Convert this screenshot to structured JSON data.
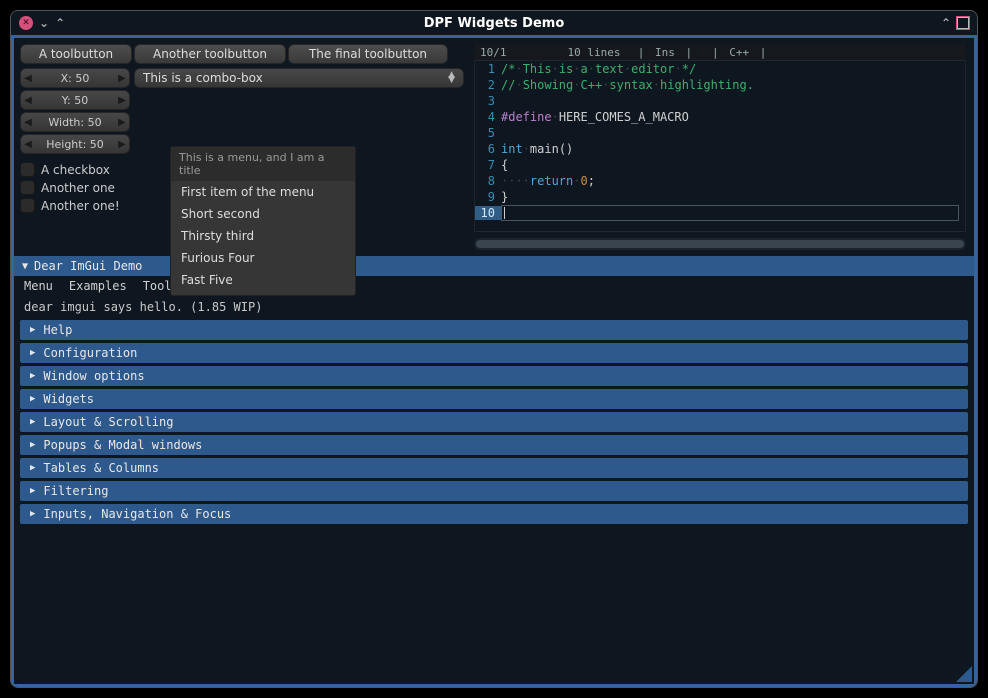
{
  "window": {
    "title": "DPF Widgets Demo"
  },
  "toolbar": {
    "b1": "A toolbutton",
    "b2": "Another toolbutton",
    "b3": "The final toolbutton"
  },
  "spinners": {
    "x": "X: 50",
    "y": "Y: 50",
    "w": "Width: 50",
    "h": "Height: 50"
  },
  "combo": {
    "label": "This is a combo-box"
  },
  "checks": {
    "c1": "A checkbox",
    "c2": "Another one",
    "c3": "Another one!"
  },
  "menu": {
    "title": "This is a menu, and I am a title",
    "items": [
      "First item of the menu",
      "Short second",
      "Thirsty third",
      "Furious Four",
      "Fast Five"
    ]
  },
  "editor": {
    "status": {
      "pos": "10/1",
      "lines": "10 lines",
      "ins": "Ins",
      "lang": "C++"
    },
    "lines": [
      {
        "n": "1",
        "parts": [
          {
            "t": "/*",
            "c": "comment"
          },
          {
            "t": "·",
            "c": "dot"
          },
          {
            "t": "This",
            "c": "comment"
          },
          {
            "t": "·",
            "c": "dot"
          },
          {
            "t": "is",
            "c": "comment"
          },
          {
            "t": "·",
            "c": "dot"
          },
          {
            "t": "a",
            "c": "comment"
          },
          {
            "t": "·",
            "c": "dot"
          },
          {
            "t": "text",
            "c": "comment"
          },
          {
            "t": "·",
            "c": "dot"
          },
          {
            "t": "editor",
            "c": "comment"
          },
          {
            "t": "·",
            "c": "dot"
          },
          {
            "t": "*/",
            "c": "comment"
          }
        ]
      },
      {
        "n": "2",
        "parts": [
          {
            "t": "//",
            "c": "comment"
          },
          {
            "t": "·",
            "c": "dot"
          },
          {
            "t": "Showing",
            "c": "comment"
          },
          {
            "t": "·",
            "c": "dot"
          },
          {
            "t": "C++",
            "c": "comment"
          },
          {
            "t": "·",
            "c": "dot"
          },
          {
            "t": "syntax",
            "c": "comment"
          },
          {
            "t": "·",
            "c": "dot"
          },
          {
            "t": "highlighting.",
            "c": "comment"
          }
        ]
      },
      {
        "n": "3",
        "parts": []
      },
      {
        "n": "4",
        "parts": [
          {
            "t": "#define",
            "c": "pp"
          },
          {
            "t": "·",
            "c": "dot"
          },
          {
            "t": "HERE_COMES_A_MACRO",
            "c": "plain"
          }
        ]
      },
      {
        "n": "5",
        "parts": []
      },
      {
        "n": "6",
        "parts": [
          {
            "t": "int",
            "c": "kw"
          },
          {
            "t": "·",
            "c": "dot"
          },
          {
            "t": "main()",
            "c": "plain"
          }
        ]
      },
      {
        "n": "7",
        "parts": [
          {
            "t": "{",
            "c": "plain"
          }
        ]
      },
      {
        "n": "8",
        "parts": [
          {
            "t": "····",
            "c": "dot"
          },
          {
            "t": "return",
            "c": "kw"
          },
          {
            "t": "·",
            "c": "dot"
          },
          {
            "t": "0",
            "c": "num"
          },
          {
            "t": ";",
            "c": "plain"
          }
        ]
      },
      {
        "n": "9",
        "parts": [
          {
            "t": "}",
            "c": "plain"
          }
        ]
      },
      {
        "n": "10",
        "parts": [],
        "current": true
      }
    ]
  },
  "imgui": {
    "title": "Dear ImGui Demo",
    "menus": [
      "Menu",
      "Examples",
      "Tools"
    ],
    "hello": "dear imgui says hello. (1.85 WIP)",
    "sections": [
      "Help",
      "Configuration",
      "Window options",
      "Widgets",
      "Layout & Scrolling",
      "Popups & Modal windows",
      "Tables & Columns",
      "Filtering",
      "Inputs, Navigation & Focus"
    ]
  }
}
